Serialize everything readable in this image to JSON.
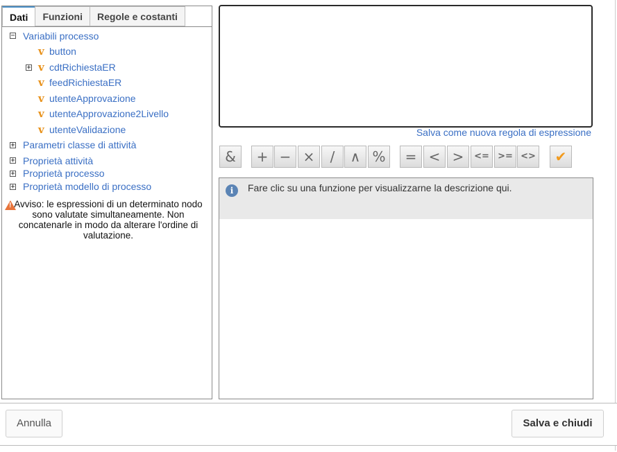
{
  "tabs": [
    "Dati",
    "Funzioni",
    "Regole e costanti"
  ],
  "tree": {
    "process_vars": {
      "label": "Variabili processo",
      "expander": "−",
      "children": [
        {
          "label": "button"
        },
        {
          "label": "cdtRichiestaER",
          "expander": "+"
        },
        {
          "label": "feedRichiestaER"
        },
        {
          "label": "utenteApprovazione"
        },
        {
          "label": "utenteApprovazione2Livello"
        },
        {
          "label": "utenteValidazione"
        }
      ]
    },
    "groups": [
      {
        "label": "Parametri classe di attività",
        "expander": "+"
      },
      {
        "label": "Proprietà attività",
        "expander": "+"
      },
      {
        "label": "Proprietà processo",
        "expander": "+"
      },
      {
        "label": "Proprietà modello di processo",
        "expander": "+"
      }
    ],
    "var_icon": "v"
  },
  "warning": "Avviso: le espressioni di un determinato nodo sono valutate simultaneamente. Non concatenarle in modo da alterare l'ordine di valutazione.",
  "save_rule": "Salva come nuova regola di espressione",
  "operators": [
    "&",
    "+",
    "−",
    "×",
    "/",
    "∧",
    "%",
    "=",
    "<",
    ">",
    "<=",
    ">=",
    "<>",
    "✔"
  ],
  "description": "Fare clic su una funzione per visualizzarne la descrizione qui.",
  "footer": {
    "cancel": "Annulla",
    "save": "Salva e chiudi"
  },
  "colors": {
    "link": "#3a6fc4",
    "var_icon": "#e8931e",
    "warning": "#e8743b",
    "info": "#5b84b5"
  }
}
